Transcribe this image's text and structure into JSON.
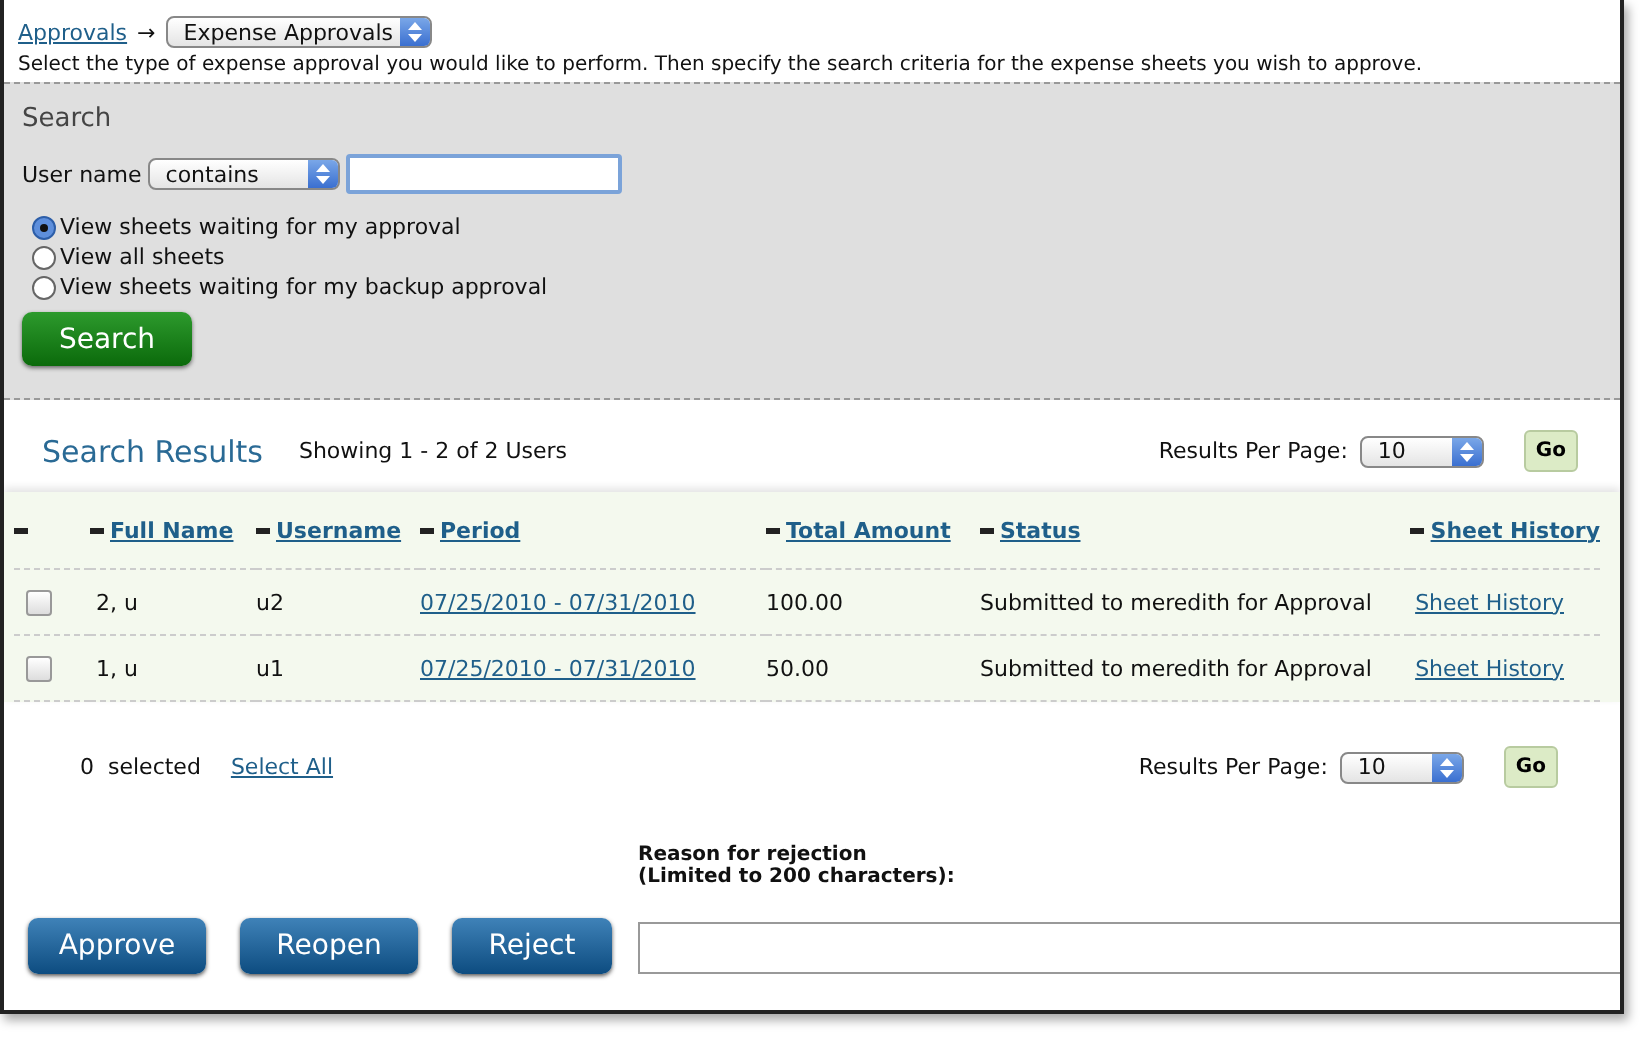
{
  "breadcrumb": {
    "link": "Approvals",
    "arrow": "→",
    "select": "Expense Approvals"
  },
  "description": "Select the type of expense approval you would like to perform. Then specify the search criteria for the expense sheets you wish to approve.",
  "search": {
    "title": "Search",
    "field_label": "User name",
    "operator": "contains",
    "options": [
      {
        "label": "View sheets waiting for my approval",
        "selected": true
      },
      {
        "label": "View all sheets",
        "selected": false
      },
      {
        "label": "View sheets waiting for my backup approval",
        "selected": false
      }
    ],
    "button": "Search"
  },
  "results": {
    "title": "Search Results",
    "summary": "Showing 1 - 2 of 2 Users",
    "per_page_label": "Results Per Page:",
    "per_page": "10",
    "go": "Go"
  },
  "table": {
    "columns": [
      "Full Name",
      "Username",
      "Period",
      "Total Amount",
      "Status",
      "Sheet History"
    ],
    "rows": [
      {
        "checked": false,
        "cells": [
          "2, u",
          "u2",
          "07/25/2010 - 07/31/2010",
          "100.00",
          "Submitted to meredith for Approval",
          "Sheet History"
        ]
      },
      {
        "checked": false,
        "cells": [
          "1, u",
          "u1",
          "07/25/2010 - 07/31/2010",
          "50.00",
          "Submitted to meredith for Approval",
          "Sheet History"
        ]
      }
    ]
  },
  "footer": {
    "count": "0",
    "selected_label": "selected",
    "select_all": "Select All",
    "per_page_label": "Results Per Page:",
    "per_page": "10",
    "go": "Go"
  },
  "actions": {
    "reason_label": "Reason for rejection",
    "reason_hint": "(Limited to 200 characters):",
    "buttons": [
      "Approve",
      "Reopen",
      "Reject"
    ]
  }
}
